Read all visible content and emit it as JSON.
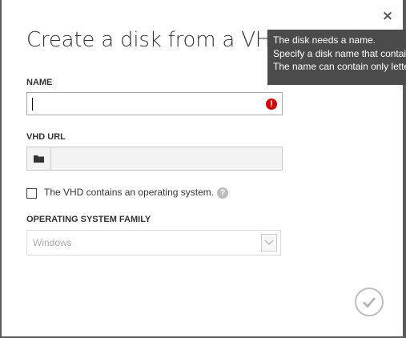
{
  "dialog": {
    "title": "Create a disk from a VHD",
    "close_label": "×"
  },
  "name_field": {
    "label": "NAME",
    "value": "",
    "error_icon": "exclamation-icon",
    "error_glyph": "!",
    "status": "error"
  },
  "vhd_url_field": {
    "label": "VHD URL",
    "value": "",
    "browse_icon": "folder-icon"
  },
  "os_checkbox": {
    "label": "The VHD contains an operating system.",
    "checked": false,
    "help_icon": "question-mark-icon",
    "help_glyph": "?"
  },
  "os_family": {
    "label": "OPERATING SYSTEM FAMILY",
    "selected": "Windows",
    "enabled": false
  },
  "confirm": {
    "icon": "checkmark-icon"
  },
  "tooltip": {
    "lines": [
      "The disk needs a name.",
      "Specify a disk name that contai",
      "The name can contain only lette"
    ]
  },
  "colors": {
    "tooltip_bg": "#4b4b4b",
    "error": "#d80000",
    "overlay": "#8a8a8a"
  }
}
